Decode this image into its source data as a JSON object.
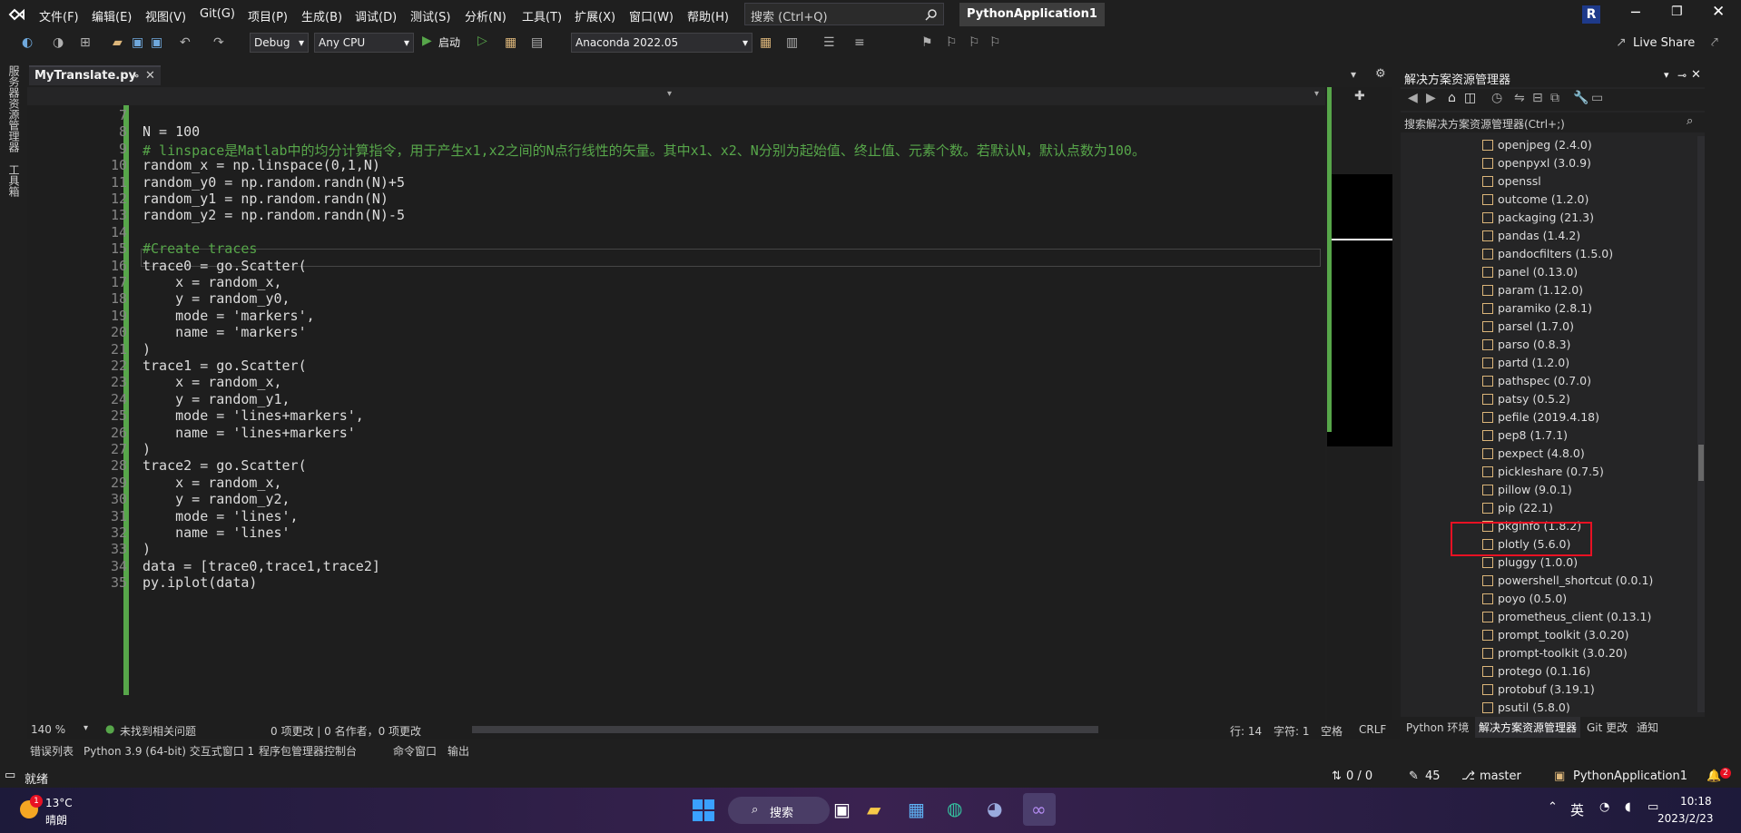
{
  "menubar": {
    "items": [
      "文件(F)",
      "编辑(E)",
      "视图(V)",
      "Git(G)",
      "项目(P)",
      "生成(B)",
      "调试(D)",
      "测试(S)",
      "分析(N)",
      "工具(T)",
      "扩展(X)",
      "窗口(W)",
      "帮助(H)"
    ],
    "search_placeholder": "搜索 (Ctrl+Q)",
    "solution_name": "PythonApplication1",
    "avatar_letter": "R"
  },
  "toolbar": {
    "config": "Debug",
    "platform": "Any CPU",
    "start_label": "启动",
    "environment": "Anaconda 2022.05",
    "live_share": "Live Share"
  },
  "left_strip": {
    "top": "服务器资源管理器",
    "bottom": "工具箱"
  },
  "editor_tab": {
    "filename": "MyTranslate.py"
  },
  "code_lines": [
    {
      "n": "7",
      "text": ""
    },
    {
      "n": "8",
      "text": "N = 100"
    },
    {
      "n": "9",
      "text": "# linspace是Matlab中的均分计算指令，用于产生x1,x2之间的N点行线性的矢量。其中x1、x2、N分别为起始值、终止值、元素个数。若默认N，默认点数为100。"
    },
    {
      "n": "10",
      "text": "random_x = np.linspace(0,1,N)"
    },
    {
      "n": "11",
      "text": "random_y0 = np.random.randn(N)+5"
    },
    {
      "n": "12",
      "text": "random_y1 = np.random.randn(N)"
    },
    {
      "n": "13",
      "text": "random_y2 = np.random.randn(N)-5"
    },
    {
      "n": "14",
      "text": ""
    },
    {
      "n": "15",
      "text": "#Create traces"
    },
    {
      "n": "16",
      "text": "trace0 = go.Scatter("
    },
    {
      "n": "17",
      "text": "    x = random_x,"
    },
    {
      "n": "18",
      "text": "    y = random_y0,"
    },
    {
      "n": "19",
      "text": "    mode = 'markers',"
    },
    {
      "n": "20",
      "text": "    name = 'markers'"
    },
    {
      "n": "21",
      "text": ")"
    },
    {
      "n": "22",
      "text": "trace1 = go.Scatter("
    },
    {
      "n": "23",
      "text": "    x = random_x,"
    },
    {
      "n": "24",
      "text": "    y = random_y1,"
    },
    {
      "n": "25",
      "text": "    mode = 'lines+markers',"
    },
    {
      "n": "26",
      "text": "    name = 'lines+markers'"
    },
    {
      "n": "27",
      "text": ")"
    },
    {
      "n": "28",
      "text": "trace2 = go.Scatter("
    },
    {
      "n": "29",
      "text": "    x = random_x,"
    },
    {
      "n": "30",
      "text": "    y = random_y2,"
    },
    {
      "n": "31",
      "text": "    mode = 'lines',"
    },
    {
      "n": "32",
      "text": "    name = 'lines'"
    },
    {
      "n": "33",
      "text": ")"
    },
    {
      "n": "34",
      "text": "data = [trace0,trace1,trace2]"
    },
    {
      "n": "35",
      "text": "py.iplot(data)"
    }
  ],
  "solution_explorer": {
    "title": "解决方案资源管理器",
    "search_placeholder": "搜索解决方案资源管理器(Ctrl+;)",
    "packages": [
      "openjpeg (2.4.0)",
      "openpyxl (3.0.9)",
      "openssl",
      "outcome (1.2.0)",
      "packaging (21.3)",
      "pandas (1.4.2)",
      "pandocfilters (1.5.0)",
      "panel (0.13.0)",
      "param (1.12.0)",
      "paramiko (2.8.1)",
      "parsel (1.7.0)",
      "parso (0.8.3)",
      "partd (1.2.0)",
      "pathspec (0.7.0)",
      "patsy (0.5.2)",
      "pefile (2019.4.18)",
      "pep8 (1.7.1)",
      "pexpect (4.8.0)",
      "pickleshare (0.7.5)",
      "pillow (9.0.1)",
      "pip (22.1)",
      "pkginfo (1.8.2)",
      "plotly (5.6.0)",
      "pluggy (1.0.0)",
      "powershell_shortcut (0.0.1)",
      "poyo (0.5.0)",
      "prometheus_client (0.13.1)",
      "prompt_toolkit (3.0.20)",
      "prompt-toolkit (3.0.20)",
      "protego (0.1.16)",
      "protobuf (3.19.1)",
      "psutil (5.8.0)"
    ],
    "bottom_tabs": [
      "Python 环境",
      "解决方案资源管理器",
      "Git 更改",
      "通知"
    ]
  },
  "editor_status": {
    "zoom": "140 %",
    "issues": "未找到相关问题",
    "changes": "0 项更改 | 0 名作者，0 项更改",
    "line": "行: 14",
    "char": "字符: 1",
    "spaces": "空格",
    "eol": "CRLF"
  },
  "bottom_tabs": [
    "错误列表",
    "Python 3.9 (64-bit) 交互式窗口 1",
    "程序包管理器控制台",
    "命令窗口",
    "输出"
  ],
  "statusbar": {
    "ready": "就绪",
    "arrows": "0 / 0",
    "pencil_count": "45",
    "branch": "master",
    "project": "PythonApplication1",
    "bell_count": "2"
  },
  "taskbar": {
    "weather_temp": "13°C",
    "weather_desc": "晴朗",
    "weather_badge": "1",
    "search": "搜索",
    "ime": "英",
    "time": "10:18",
    "date": "2023/2/23"
  }
}
